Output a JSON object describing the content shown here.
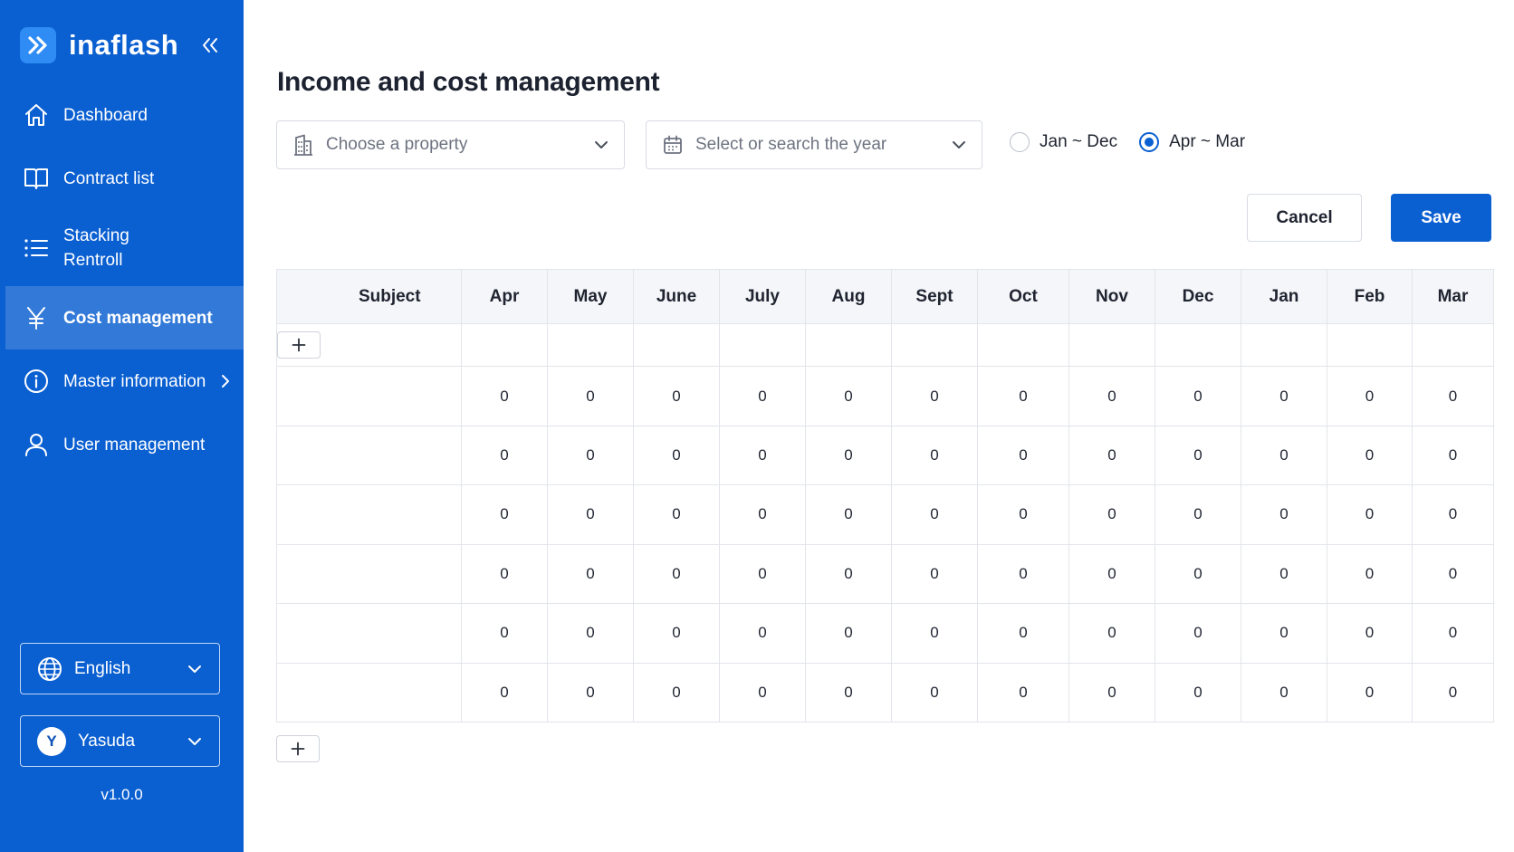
{
  "app": {
    "name": "inaflash"
  },
  "nav": [
    {
      "id": "dashboard",
      "label": "Dashboard",
      "icon": "home-icon"
    },
    {
      "id": "contract-list",
      "label": "Contract list",
      "icon": "book-icon"
    },
    {
      "id": "stacking-rentroll",
      "label": "Stacking\nRentroll",
      "icon": "list-icon"
    },
    {
      "id": "cost-management",
      "label": "Cost management",
      "icon": "yen-icon",
      "active": true
    },
    {
      "id": "master-information",
      "label": "Master information",
      "icon": "info-icon",
      "has_submenu": true
    },
    {
      "id": "user-management",
      "label": "User management",
      "icon": "user-icon"
    }
  ],
  "language": {
    "selected": "English"
  },
  "user": {
    "initial": "Y",
    "name": "Yasuda"
  },
  "version": "v1.0.0",
  "page": {
    "title": "Income and cost management"
  },
  "filters": {
    "property_placeholder": "Choose a property",
    "year_placeholder": "Select or search the year",
    "period_options": [
      {
        "label": "Jan ~ Dec",
        "checked": false
      },
      {
        "label": "Apr ~ Mar",
        "checked": true
      }
    ]
  },
  "actions": {
    "cancel_label": "Cancel",
    "save_label": "Save"
  },
  "table": {
    "columns": [
      "Subject",
      "Apr",
      "May",
      "June",
      "July",
      "Aug",
      "Sept",
      "Oct",
      "Nov",
      "Dec",
      "Jan",
      "Feb",
      "Mar"
    ],
    "rows": [
      {
        "subject": "",
        "values": [
          "0",
          "0",
          "0",
          "0",
          "0",
          "0",
          "0",
          "0",
          "0",
          "0",
          "0",
          "0"
        ]
      },
      {
        "subject": "",
        "values": [
          "0",
          "0",
          "0",
          "0",
          "0",
          "0",
          "0",
          "0",
          "0",
          "0",
          "0",
          "0"
        ]
      },
      {
        "subject": "",
        "values": [
          "0",
          "0",
          "0",
          "0",
          "0",
          "0",
          "0",
          "0",
          "0",
          "0",
          "0",
          "0"
        ]
      },
      {
        "subject": "",
        "values": [
          "0",
          "0",
          "0",
          "0",
          "0",
          "0",
          "0",
          "0",
          "0",
          "0",
          "0",
          "0"
        ]
      },
      {
        "subject": "",
        "values": [
          "0",
          "0",
          "0",
          "0",
          "0",
          "0",
          "0",
          "0",
          "0",
          "0",
          "0",
          "0"
        ]
      },
      {
        "subject": "",
        "values": [
          "0",
          "0",
          "0",
          "0",
          "0",
          "0",
          "0",
          "0",
          "0",
          "0",
          "0",
          "0"
        ]
      }
    ]
  },
  "colors": {
    "sidebar": "#0a5fd1",
    "accent": "#0a5fd1",
    "logo": "#2f8cf5"
  }
}
